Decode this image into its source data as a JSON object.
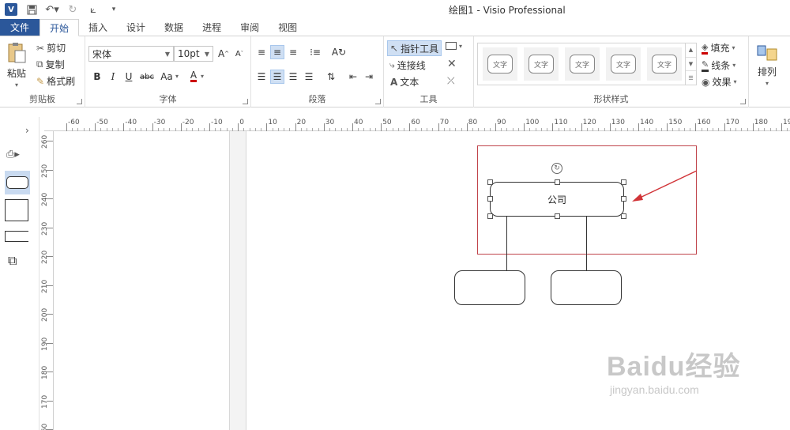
{
  "window": {
    "title": "绘图1 - Visio Professional",
    "app_icon": "V"
  },
  "quick_access": [
    "save-icon",
    "undo-icon",
    "redo-icon",
    "connector-icon",
    "customize-icon"
  ],
  "tabs": [
    {
      "label": "文件"
    },
    {
      "label": "开始"
    },
    {
      "label": "插入"
    },
    {
      "label": "设计"
    },
    {
      "label": "数据"
    },
    {
      "label": "进程"
    },
    {
      "label": "审阅"
    },
    {
      "label": "视图"
    }
  ],
  "ribbon": {
    "clipboard": {
      "paste": "粘贴",
      "cut": "剪切",
      "copy": "复制",
      "format_painter": "格式刷",
      "label": "剪贴板"
    },
    "font": {
      "name": "宋体",
      "size": "10pt",
      "label": "字体",
      "bold": "B",
      "italic": "I",
      "underline": "U",
      "strike": "abc",
      "case": "Aa",
      "color": "A"
    },
    "paragraph": {
      "label": "段落"
    },
    "tools": {
      "pointer": "指针工具",
      "connector": "连接线",
      "text": "文本",
      "label": "工具"
    },
    "shape_styles": {
      "label": "形状样式",
      "items": [
        "文字",
        "文字",
        "文字",
        "文字",
        "文字"
      ]
    },
    "fill": "填充",
    "line": "线条",
    "effects": "效果",
    "arrange": "排列"
  },
  "ruler": {
    "h": [
      "-60",
      "-50",
      "-40",
      "-30",
      "-20",
      "-10",
      "0",
      "10",
      "20",
      "30",
      "40",
      "50",
      "60",
      "70",
      "80",
      "90",
      "100",
      "110",
      "120",
      "130",
      "140",
      "150",
      "160",
      "170",
      "180",
      "190"
    ],
    "v": [
      "260",
      "250",
      "240",
      "230",
      "220",
      "210",
      "200",
      "190",
      "180",
      "170",
      "160"
    ]
  },
  "diagram": {
    "top_shape": "公司"
  },
  "watermark": {
    "brand": "Baidu经验",
    "url": "jingyan.baidu.com"
  },
  "colors": {
    "accent": "#2b579a",
    "selection": "#c0444b",
    "arrow": "#d13438"
  }
}
